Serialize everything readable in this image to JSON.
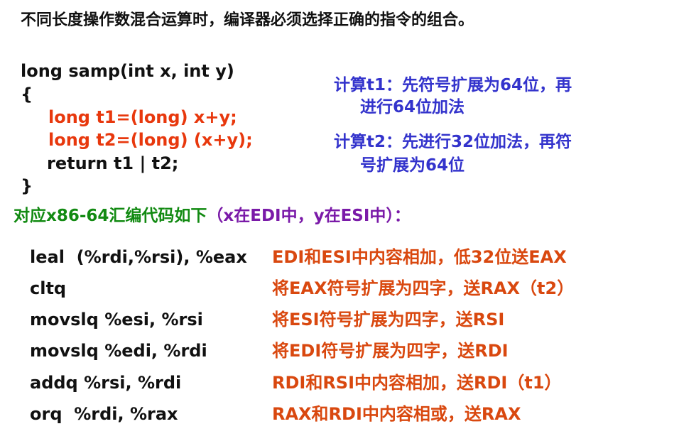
{
  "title": "不同长度操作数混合运算时，编译器必须选择正确的指令的组合。",
  "c_code": {
    "signature": "long samp(int x, int y)",
    "open_brace": "{",
    "line_t1": "long t1=(long) x+y;",
    "line_t2": "long t2=(long) (x+y);",
    "line_return": "return t1 | t2;",
    "close_brace": "}"
  },
  "notes": {
    "t1_line1": "计算t1：先符号扩展为64位，再",
    "t1_line2": "进行64位加法",
    "t2_line1": "计算t2：先进行32位加法，再符",
    "t2_line2": "号扩展为64位"
  },
  "asm_header": {
    "prefix": "对应x86-64汇编代码如下",
    "suffix": "（x在EDI中，y在ESI中）："
  },
  "asm": [
    {
      "code": "leal  (%rdi,%rsi), %eax",
      "desc": "EDI和ESI中内容相加，低32位送EAX"
    },
    {
      "code": "cltq",
      "desc": "将EAX符号扩展为四字，送RAX（t2）"
    },
    {
      "code": "movslq %esi, %rsi",
      "desc": "将ESI符号扩展为四字，送RSI"
    },
    {
      "code": "movslq %edi, %rdi",
      "desc": "将EDI符号扩展为四字，送RDI"
    },
    {
      "code": "addq %rsi, %rdi",
      "desc": "RDI和RSI中内容相加，送RDI（t1）"
    },
    {
      "code": "orq  %rdi, %rax",
      "desc": "RAX和RDI中内容相或，送RAX"
    }
  ],
  "colors": {
    "code_highlight": "#e8380d",
    "note_blue": "#3333cc",
    "header_green": "#128a12",
    "header_purple": "#7a1aa8",
    "asm_desc": "#d9480f"
  }
}
